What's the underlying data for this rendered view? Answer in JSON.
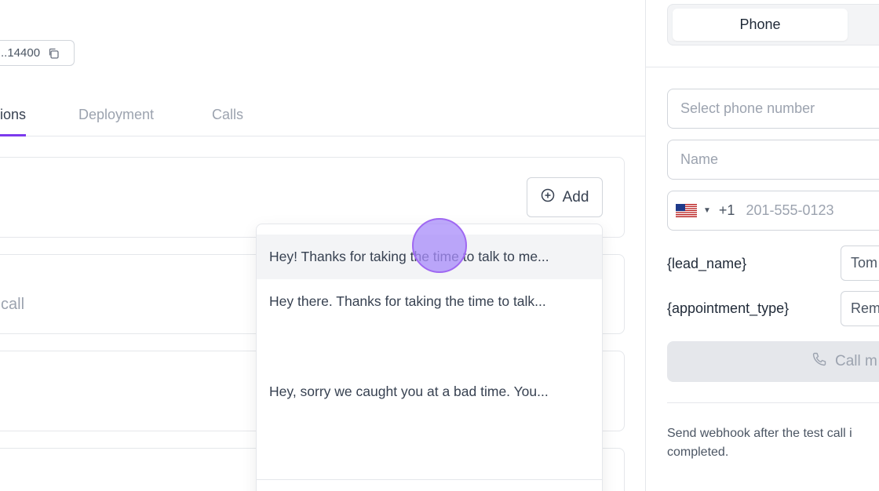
{
  "agent": {
    "id_text": "..14400",
    "copy_icon": "copy-icon"
  },
  "tabs": [
    {
      "label": "ions",
      "active": true
    },
    {
      "label": "Deployment",
      "active": false
    },
    {
      "label": "Calls",
      "active": false
    }
  ],
  "cards": {
    "second_text": "call"
  },
  "add_button": {
    "label": "Add",
    "icon": "plus-circle-icon"
  },
  "dropdown": {
    "options": [
      "Hey! Thanks for taking the time to talk to me...",
      "Hey there. Thanks for taking the time to talk...",
      "Hey, sorry we caught you at a bad time. You..."
    ]
  },
  "sidebar": {
    "mode_tab": "Phone",
    "phone_select_placeholder": "Select phone number",
    "name_placeholder": "Name",
    "country_code": "+1",
    "phone_placeholder": "201-555-0123",
    "variables": [
      {
        "label": "{lead_name}",
        "value": "Tom"
      },
      {
        "label": "{appointment_type}",
        "value": "Rem"
      }
    ],
    "call_button_label": "Call m",
    "webhook_text": "Send webhook after the test call i completed."
  },
  "colors": {
    "accent": "#7c3aed",
    "cursor": "#a78bfa"
  }
}
